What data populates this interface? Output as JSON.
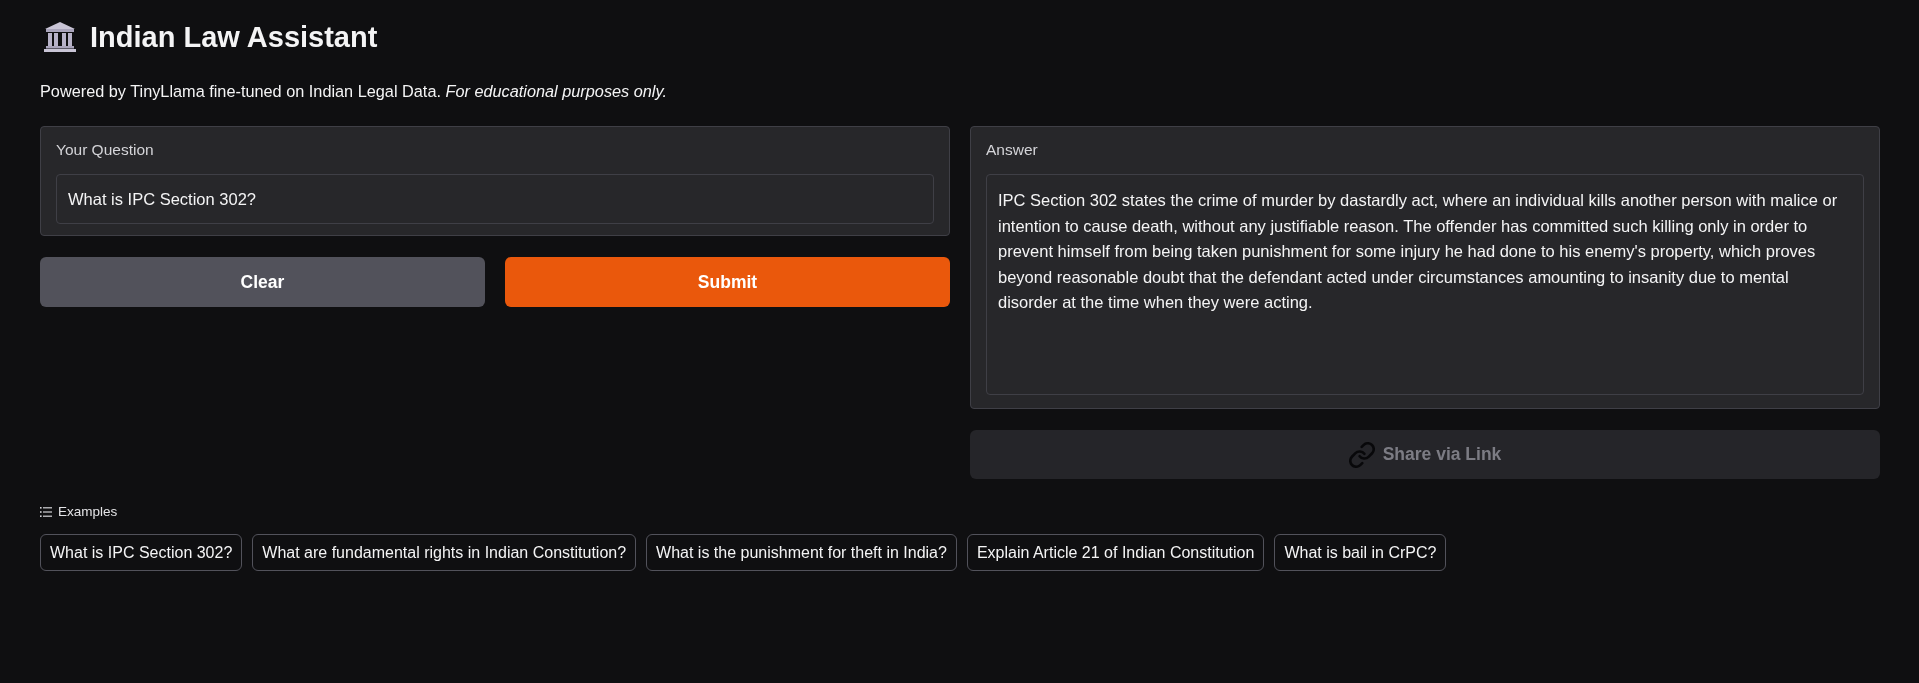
{
  "header": {
    "title": "Indian Law Assistant",
    "subtitle": "Powered by TinyLlama fine-tuned on Indian Legal Data. *For educational purposes only.*"
  },
  "question": {
    "label": "Your Question",
    "value": "What is IPC Section 302?"
  },
  "buttons": [
    {
      "label": "Clear",
      "kind": "secondary"
    },
    {
      "label": "Submit",
      "kind": "primary"
    }
  ],
  "answer": {
    "label": "Answer",
    "value": "IPC Section 302 states the crime of murder by dastardly act, where an individual kills another person with malice or intention to cause death, without any justifiable reason. The offender has committed such killing only in order to prevent himself from being taken punishment for some injury he had done to his enemy's property, which proves beyond reasonable doubt that the defendant acted under circumstances amounting to insanity due to mental disorder at the time when they were acting."
  },
  "share_button": {
    "label": "Share via Link",
    "disabled": true
  },
  "examples": {
    "label": "Examples",
    "items": [
      "What is IPC Section 302?",
      "What are fundamental rights in Indian Constitution?",
      "What is the punishment for theft in India?",
      "Explain Article 21 of Indian Constitution",
      "What is bail in CrPC?"
    ]
  }
}
